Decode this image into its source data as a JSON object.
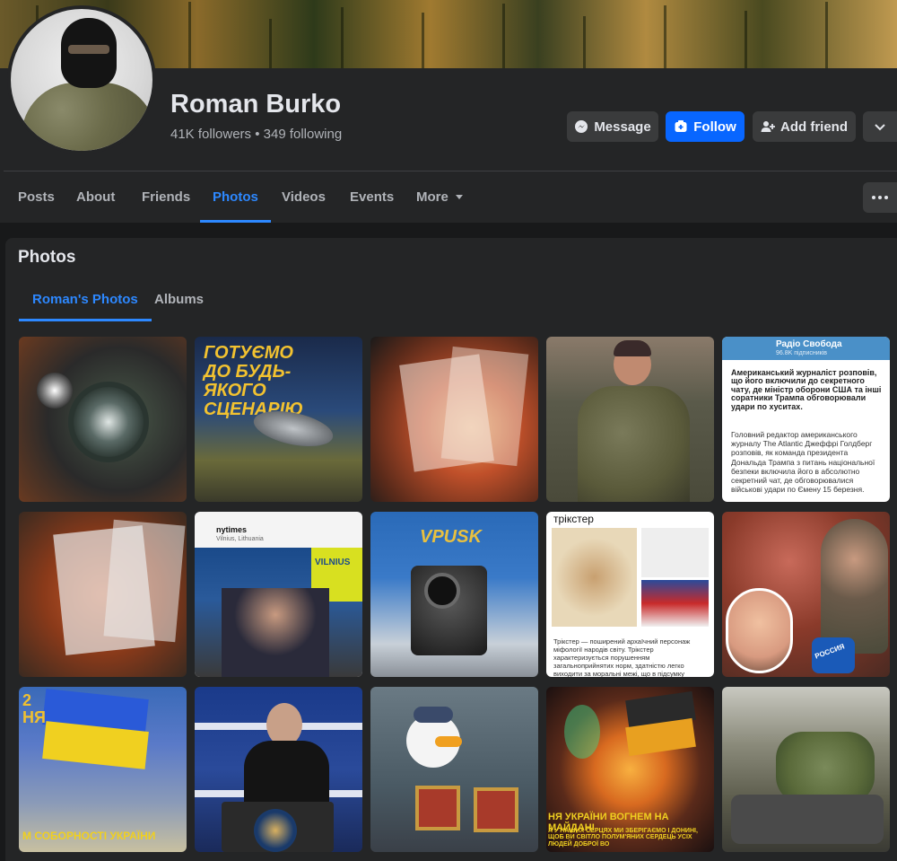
{
  "profile": {
    "name": "Roman Burko",
    "followers_line": "41K followers • 349 following"
  },
  "actions": {
    "message": "Message",
    "follow": "Follow",
    "add_friend": "Add friend"
  },
  "nav": {
    "tabs": [
      "Posts",
      "About",
      "Friends",
      "Photos",
      "Videos",
      "Events",
      "More"
    ],
    "active": "Photos"
  },
  "photos": {
    "title": "Photos",
    "subtabs": [
      "Roman's Photos",
      "Albums"
    ]
  },
  "photo_texts": {
    "p2_headline": "ГОТУЄМО ДО БУДЬ-ЯКОГО СЦЕНАРІЮ",
    "p5_channel": "Радіо Свобода",
    "p5_subscribers": "96.8K підписників",
    "p5_body": "Американський журналіст розповів, що його включили до секретного чату, де міністр оборони США та інші соратники Трампа обговорювали удари по хуситах.",
    "p5_body2": "Головний редактор американського журналу The Atlantic Джеффрі Голдберг розповів, як команда президента Дональда Трампа з питань національної безпеки включила його в абсолютно секретний чат, де обговорювалися військові удари по Ємену 15 березня.",
    "p7_source": "nytimes",
    "p7_place": "Vilnius, Lithuania",
    "p7_sign": "VILNIUS",
    "p8_brand": "VPUSK",
    "p9_title": "трікстер",
    "p9_caption": "Трікстер — поширений архаїчний персонаж міфології народів світу. Трікстер характеризується порушенням загальноприйнятих норм, здатністю легко виходити за моральні межі, що в підсумку",
    "p10_badge": "РОССИЯ",
    "p11_text": "М СОБОРНОСТІ УКРАЇНИ",
    "p11_side": "2 НЯ",
    "p14_text": "НЯ УКРАЇНИ ВОГНЕМ НА МАЙДАНІ",
    "p14_text2": "А У НАШИХ СЕРЦЯХ МИ ЗБЕРІГАЄМО І ДОНИНІ, ЩОБ ВИ СВІТЛО ПОЛУМ'ЯНИХ СЕРДЕЦЬ УСІХ ЛЮДЕЙ ДОБРОЇ ВО"
  },
  "colors": {
    "accent": "#2d88ff",
    "follow_bg": "#0866ff"
  }
}
